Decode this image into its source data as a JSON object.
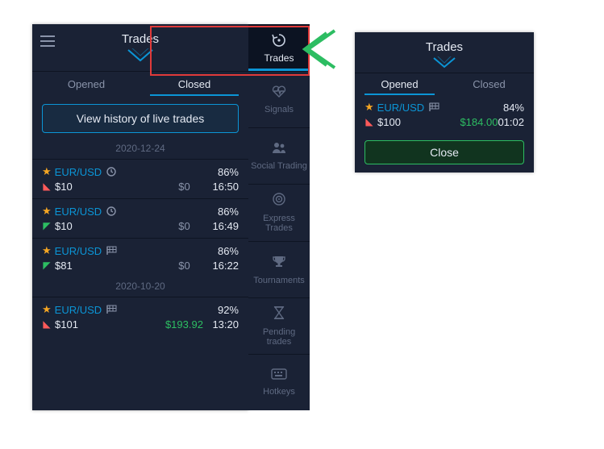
{
  "left": {
    "title": "Trades",
    "tabs": {
      "opened": "Opened",
      "closed": "Closed",
      "activeIndex": 1
    },
    "history_btn": "View history of live trades",
    "dates": {
      "d1": "2020-12-24",
      "d2": "2020-10-20"
    },
    "rows": [
      {
        "pair": "EUR/USD",
        "marker": "clock",
        "pct": "86%",
        "dir": "down",
        "amt": "$10",
        "result": "$0",
        "result_color": "gray",
        "time": "16:50"
      },
      {
        "pair": "EUR/USD",
        "marker": "clock",
        "pct": "86%",
        "dir": "up",
        "amt": "$10",
        "result": "$0",
        "result_color": "gray",
        "time": "16:49"
      },
      {
        "pair": "EUR/USD",
        "marker": "flag",
        "pct": "86%",
        "dir": "up",
        "amt": "$81",
        "result": "$0",
        "result_color": "gray",
        "time": "16:22"
      },
      {
        "pair": "EUR/USD",
        "marker": "flag",
        "pct": "92%",
        "dir": "down",
        "amt": "$101",
        "result": "$193.92",
        "result_color": "green",
        "time": "13:20"
      }
    ]
  },
  "rail": {
    "selected": {
      "label": "Trades"
    },
    "items": [
      {
        "label": "Signals"
      },
      {
        "label": "Social Trading"
      },
      {
        "label": "Express Trades"
      },
      {
        "label": "Tournaments"
      },
      {
        "label": "Pending trades"
      },
      {
        "label": "Hotkeys"
      }
    ]
  },
  "right": {
    "title": "Trades",
    "tabs": {
      "opened": "Opened",
      "closed": "Closed",
      "activeIndex": 0
    },
    "row": {
      "pair": "EUR/USD",
      "marker": "flag",
      "pct": "84%",
      "dir": "down",
      "amt": "$100",
      "result": "$184.00",
      "time": "01:02"
    },
    "close_btn": "Close"
  }
}
